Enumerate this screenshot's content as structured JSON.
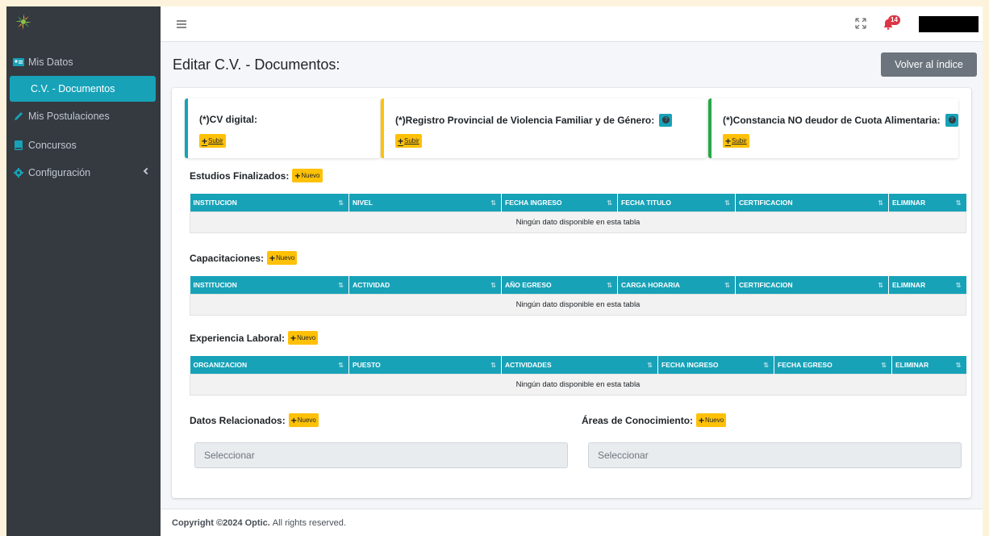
{
  "sidebar": {
    "items": [
      {
        "label": "Mis Datos",
        "icon": "id-card-icon"
      },
      {
        "label": "C.V. - Documentos"
      },
      {
        "label": "Mis Postulaciones",
        "icon": "pencil-icon"
      },
      {
        "label": "Concursos",
        "icon": "book-icon"
      },
      {
        "label": "Configuración",
        "icon": "gear-icon"
      }
    ]
  },
  "navbar": {
    "notification_count": "14"
  },
  "page": {
    "title": "Editar C.V. - Documentos:",
    "back_button": "Volver al índice"
  },
  "documents": [
    {
      "label": "(*)CV digital:",
      "button": "Subir",
      "color": "#17a2b8"
    },
    {
      "label": "(*)Registro Provincial de Violencia Familiar y de Género:",
      "button": "Subir",
      "color": "#ffc107"
    },
    {
      "label": "(*)Constancia NO deudor de Cuota Alimentaria:",
      "button": "Subir",
      "color": "#28a745"
    }
  ],
  "new_label": "Nuevo",
  "empty_table": "Ningún dato disponible en esta tabla",
  "sections": {
    "estudios": {
      "label": "Estudios Finalizados:",
      "columns": [
        "INSTITUCION",
        "NIVEL",
        "FECHA INGRESO",
        "FECHA TITULO",
        "CERTIFICACION",
        "ELIMINAR"
      ]
    },
    "capacitaciones": {
      "label": "Capacitaciones:",
      "columns": [
        "INSTITUCION",
        "ACTIVIDAD",
        "AÑO EGRESO",
        "CARGA HORARIA",
        "CERTIFICACION",
        "ELIMINAR"
      ]
    },
    "experiencia": {
      "label": "Experiencia Laboral:",
      "columns": [
        "ORGANIZACION",
        "PUESTO",
        "ACTIVIDADES",
        "FECHA INGRESO",
        "FECHA EGRESO",
        "ELIMINAR"
      ]
    },
    "datos": {
      "label": "Datos Relacionados:",
      "placeholder": "Seleccionar"
    },
    "areas": {
      "label": "Áreas de Conocimiento:",
      "placeholder": "Seleccionar"
    }
  },
  "footer": {
    "copyright": "Copyright ©2024 Optic.",
    "rights": "All rights reserved."
  }
}
